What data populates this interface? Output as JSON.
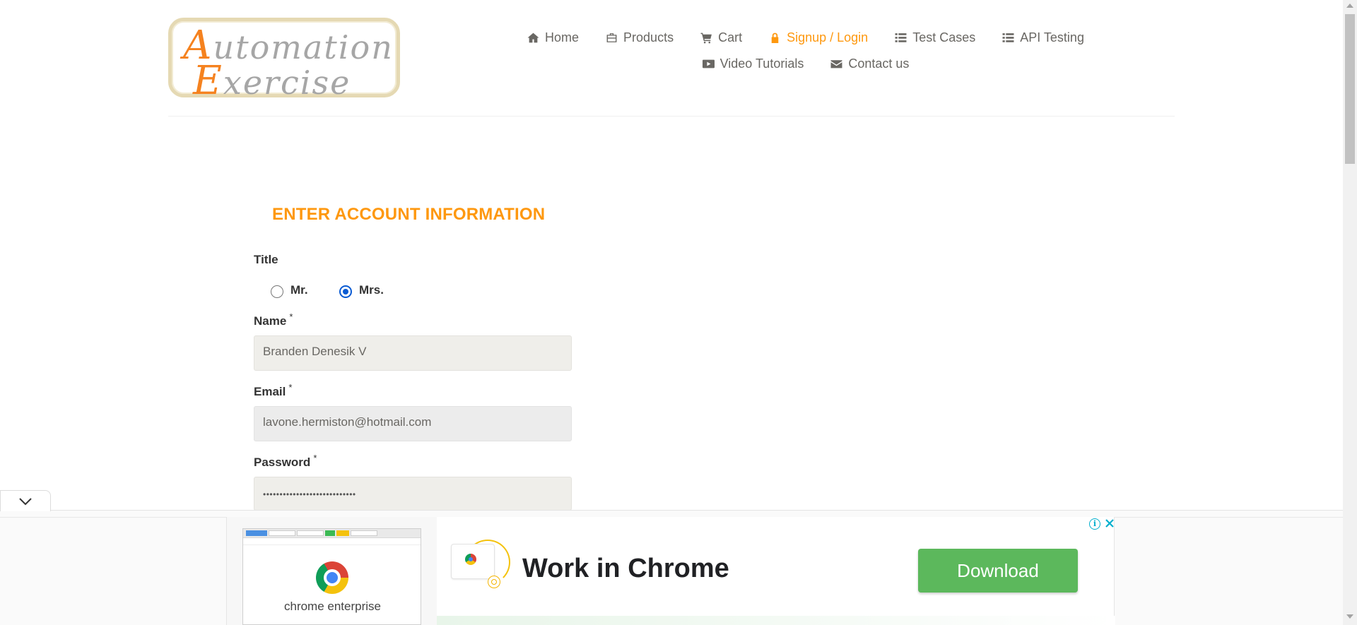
{
  "logo": {
    "line1_cap": "A",
    "line1_rest": "utomation",
    "line2_cap": "E",
    "line2_rest": "xercise"
  },
  "nav": {
    "items": [
      {
        "label": "Home",
        "icon": "home-icon"
      },
      {
        "label": "Products",
        "icon": "briefcase-icon"
      },
      {
        "label": "Cart",
        "icon": "cart-icon"
      },
      {
        "label": "Signup / Login",
        "icon": "lock-icon",
        "active": true
      },
      {
        "label": "Test Cases",
        "icon": "list-icon"
      },
      {
        "label": "API Testing",
        "icon": "list-icon"
      },
      {
        "label": "Video Tutorials",
        "icon": "youtube-play-icon"
      },
      {
        "label": "Contact us",
        "icon": "envelope-icon"
      }
    ]
  },
  "form": {
    "title": "ENTER ACCOUNT INFORMATION",
    "title_label": "Title",
    "title_options": [
      {
        "label": "Mr.",
        "checked": false
      },
      {
        "label": "Mrs.",
        "checked": true
      }
    ],
    "name_label": "Name",
    "name_value": "Branden Denesik V",
    "email_label": "Email",
    "email_value": "lavone.hermiston@hotmail.com",
    "password_label": "Password",
    "password_value": "••••••••••••••••••••••••••••",
    "required_mark": "*"
  },
  "ad": {
    "caption": "chrome enterprise",
    "headline": "Work in Chrome",
    "button_label": "Download",
    "info_glyph": "i"
  },
  "colors": {
    "accent": "#fe980f",
    "button": "#5cb85c",
    "radio": "#0a5bd3"
  }
}
